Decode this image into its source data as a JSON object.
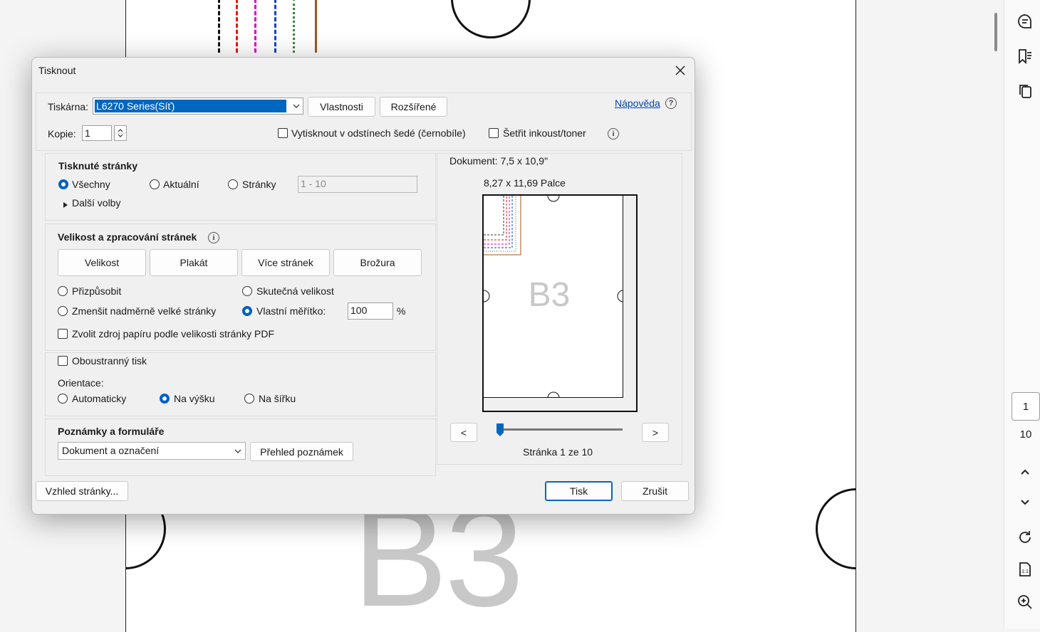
{
  "background": {
    "page_watermark": "B3",
    "page_current": "1",
    "page_total": "10"
  },
  "right_toolbar": {
    "icons": [
      "comment-icon",
      "bookmark-list-icon",
      "pages-icon",
      "chevron-up-icon",
      "chevron-down-icon",
      "rotate-icon",
      "actual-size-icon",
      "zoom-in-icon"
    ]
  },
  "dialog": {
    "title": "Tisknout",
    "printer": {
      "label": "Tiskárna:",
      "value": "L6270 Series(Síť)",
      "properties_button": "Vlastnosti",
      "advanced_button": "Rozšířené",
      "help_link": "Nápověda",
      "help_icon": "?"
    },
    "copies": {
      "label": "Kopie:",
      "value": "1"
    },
    "grayscale_checkbox": "Vytisknout v odstínech šedé (černobíle)",
    "save_ink_checkbox": "Šetřit inkoust/toner",
    "pages_section": {
      "title": "Tisknuté stránky",
      "all": "Všechny",
      "current": "Aktuální",
      "pages": "Stránky",
      "pages_range_placeholder": "1 - 10",
      "more_options": "Další volby"
    },
    "size_section": {
      "title": "Velikost a zpracování stránek",
      "tab_size": "Velikost",
      "tab_poster": "Plakát",
      "tab_multiple": "Více stránek",
      "tab_booklet": "Brožura",
      "fit": "Přizpůsobit",
      "actual_size": "Skutečná velikost",
      "shrink": "Zmenšit nadměrně velké stránky",
      "custom_scale": "Vlastní měřítko:",
      "scale_value": "100",
      "scale_unit": "%",
      "paper_source": "Zvolit zdroj papíru podle velikosti stránky PDF"
    },
    "duplex_checkbox": "Oboustranný tisk",
    "orientation": {
      "label": "Orientace:",
      "auto": "Automaticky",
      "portrait": "Na výšku",
      "landscape": "Na šířku"
    },
    "annotations": {
      "title": "Poznámky a formuláře",
      "select_value": "Dokument a označení",
      "summarize_button": "Přehled poznámek"
    },
    "preview": {
      "document_size": "Dokument: 7,5 x 10,9\"",
      "paper_size": "8,27 x 11,69 Palce",
      "thumbnail_text": "B3",
      "prev": "<",
      "next": ">",
      "page_status": "Stránka 1 ze 10",
      "slider_position": 0
    },
    "page_setup_button": "Vzhled stránky...",
    "print_button": "Tisk",
    "cancel_button": "Zrušit"
  }
}
